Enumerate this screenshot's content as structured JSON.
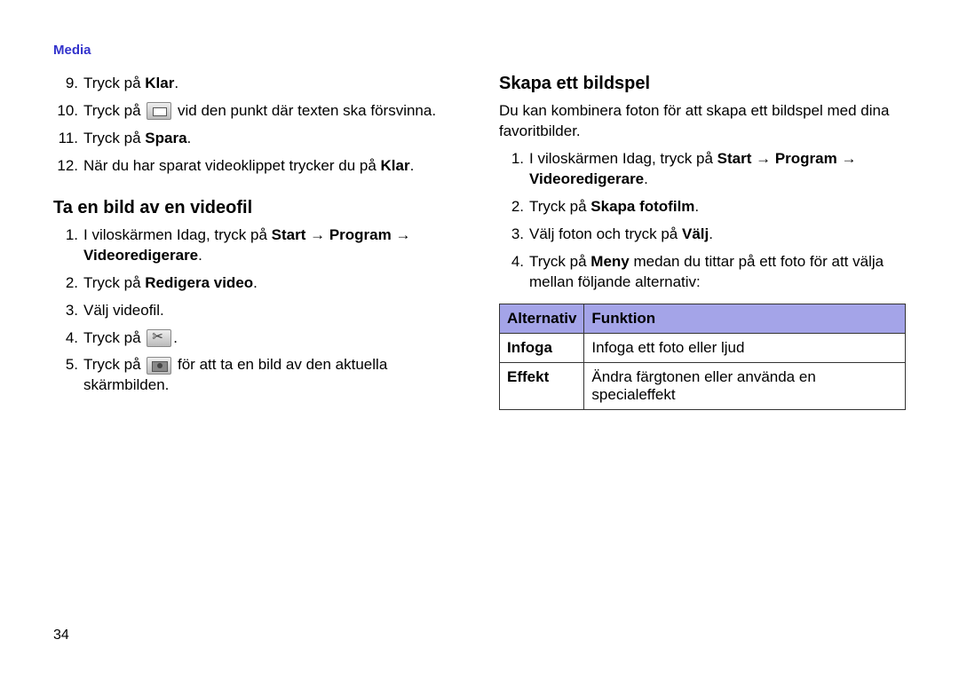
{
  "header": "Media",
  "pageNumber": "34",
  "left": {
    "steps_a": [
      {
        "n": "9.",
        "pre": "Tryck på ",
        "bold": "Klar",
        "post": "."
      },
      {
        "n": "10.",
        "pre": "Tryck på ",
        "icon": "slide",
        "post2": " vid den punkt där texten ska försvinna."
      },
      {
        "n": "11.",
        "pre": "Tryck på ",
        "bold": "Spara",
        "post": "."
      },
      {
        "n": "12.",
        "pre": "När du har sparat videoklippet trycker du på ",
        "bold": "Klar",
        "post": "."
      }
    ],
    "heading": "Ta en bild av en videofil",
    "steps_b": [
      {
        "n": "1.",
        "pre": "I viloskärmen Idag, tryck på ",
        "bold": "Start",
        "arrow1": " → ",
        "bold2": "Program",
        "arrow2": " → ",
        "bold3": "Videoredigerare",
        "post": "."
      },
      {
        "n": "2.",
        "pre": "Tryck på ",
        "bold": "Redigera video",
        "post": "."
      },
      {
        "n": "3.",
        "pre": "Välj videofil."
      },
      {
        "n": "4.",
        "pre": "Tryck på ",
        "icon": "scissors",
        "post2": "."
      },
      {
        "n": "5.",
        "pre": "Tryck på ",
        "icon": "camera",
        "post2": " för att ta en bild av den aktuella skärmbilden."
      }
    ]
  },
  "right": {
    "heading": "Skapa ett bildspel",
    "intro": "Du kan kombinera foton för att skapa ett bildspel med dina favoritbilder.",
    "steps": [
      {
        "n": "1.",
        "pre": "I viloskärmen Idag, tryck på ",
        "bold": "Start",
        "arrow1": " → ",
        "bold2": "Program",
        "arrow2": " → ",
        "bold3": "Videoredigerare",
        "post": "."
      },
      {
        "n": "2.",
        "pre": "Tryck på ",
        "bold": "Skapa fotofilm",
        "post": "."
      },
      {
        "n": "3.",
        "pre": "Välj foton och tryck på ",
        "bold": "Välj",
        "post": "."
      },
      {
        "n": "4.",
        "pre": "Tryck på ",
        "bold": "Meny",
        "post": " medan du tittar på ett foto för att välja mellan följande alternativ:"
      }
    ],
    "table": {
      "head1": "Alternativ",
      "head2": "Funktion",
      "rows": [
        {
          "a": "Infoga",
          "b": "Infoga ett foto eller ljud"
        },
        {
          "a": "Effekt",
          "b": "Ändra färgtonen eller använda en specialeffekt"
        }
      ]
    }
  }
}
